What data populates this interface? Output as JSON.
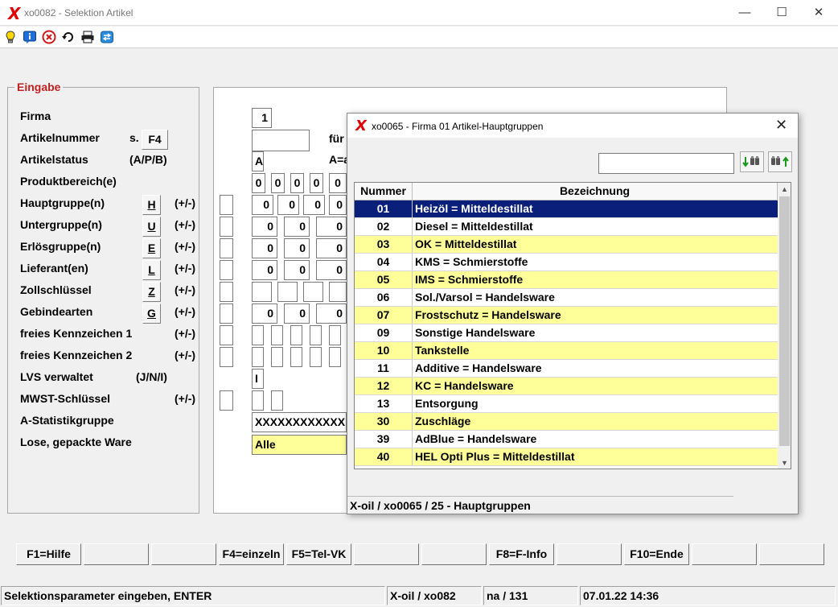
{
  "window": {
    "title": "xo0082 - Selektion Artikel",
    "logo": "X"
  },
  "toolbar": {
    "icons": [
      "lightbulb-icon",
      "info-icon",
      "stop-icon",
      "refresh-icon",
      "printer-icon",
      "transfer-icon"
    ]
  },
  "eingabe": {
    "title": "Eingabe",
    "labels": [
      "Firma",
      "Artikelnummer",
      "Artikelstatus",
      "Produktbereich(e)",
      "Hauptgruppe(n)",
      "Untergruppe(n)",
      "Erlösgruppe(n)",
      "Lieferant(en)",
      "Zollschlüssel",
      "Gebindearten",
      "freies Kennzeichen 1",
      "freies Kennzeichen 2",
      "LVS verwaltet",
      "MWST-Schlüssel",
      "A-Statistikgruppe",
      "Lose, gepackte Ware"
    ],
    "hints": {
      "artikelnummer": "s.",
      "artikelstatus": "(A/P/B)",
      "plusminus": "(+/-)",
      "lvs": "(J/N/I)"
    },
    "keys": {
      "f4": "F4",
      "h": "H",
      "u": "U",
      "e": "E",
      "l": "L",
      "z": "Z",
      "g": "G"
    }
  },
  "form": {
    "firma": "1",
    "artikelnummer": "",
    "fuer_label": "für",
    "artikelstatus": "A",
    "status_hint": "A=a",
    "zero": "0",
    "lvs": "I",
    "statistik": "XXXXXXXXXXXX",
    "lose": "Alle"
  },
  "dialog": {
    "title": "xo0065 - Firma 01 Artikel-Hauptgruppen",
    "logo": "X",
    "search_value": "",
    "columns": [
      "Nummer",
      "Bezeichnung"
    ],
    "rows": [
      {
        "nummer": "01",
        "bezeichnung": "Heizöl = Mitteldestillat"
      },
      {
        "nummer": "02",
        "bezeichnung": "Diesel = Mitteldestillat"
      },
      {
        "nummer": "03",
        "bezeichnung": "OK = Mitteldestillat"
      },
      {
        "nummer": "04",
        "bezeichnung": "KMS = Schmierstoffe"
      },
      {
        "nummer": "05",
        "bezeichnung": "IMS = Schmierstoffe"
      },
      {
        "nummer": "06",
        "bezeichnung": "Sol./Varsol = Handelsware"
      },
      {
        "nummer": "07",
        "bezeichnung": "Frostschutz = Handelsware"
      },
      {
        "nummer": "09",
        "bezeichnung": "Sonstige Handelsware"
      },
      {
        "nummer": "10",
        "bezeichnung": "Tankstelle"
      },
      {
        "nummer": "11",
        "bezeichnung": "Additive = Handelsware"
      },
      {
        "nummer": "12",
        "bezeichnung": "KC = Handelsware"
      },
      {
        "nummer": "13",
        "bezeichnung": "Entsorgung"
      },
      {
        "nummer": "30",
        "bezeichnung": "Zuschläge"
      },
      {
        "nummer": "39",
        "bezeichnung": "AdBlue = Handelsware"
      },
      {
        "nummer": "40",
        "bezeichnung": "HEL Opti Plus = Mitteldestillat"
      }
    ],
    "status": "X-oil / xo0065 / 25 - Hauptgruppen"
  },
  "fkeys": [
    "F1=Hilfe",
    "",
    "",
    "F4=einzeln",
    "F5=Tel-VK",
    "",
    "",
    "F8=F-Info",
    "",
    "F10=Ende",
    "",
    ""
  ],
  "statusbar": {
    "message": "Selektionsparameter eingeben, ENTER",
    "app": "X-oil / xo082",
    "info": "na / 131",
    "datetime": "07.01.22 14:36"
  },
  "colors": {
    "selection": "#0a1f7a",
    "alt_row": "#ffff99",
    "accent_red": "#c02020"
  }
}
